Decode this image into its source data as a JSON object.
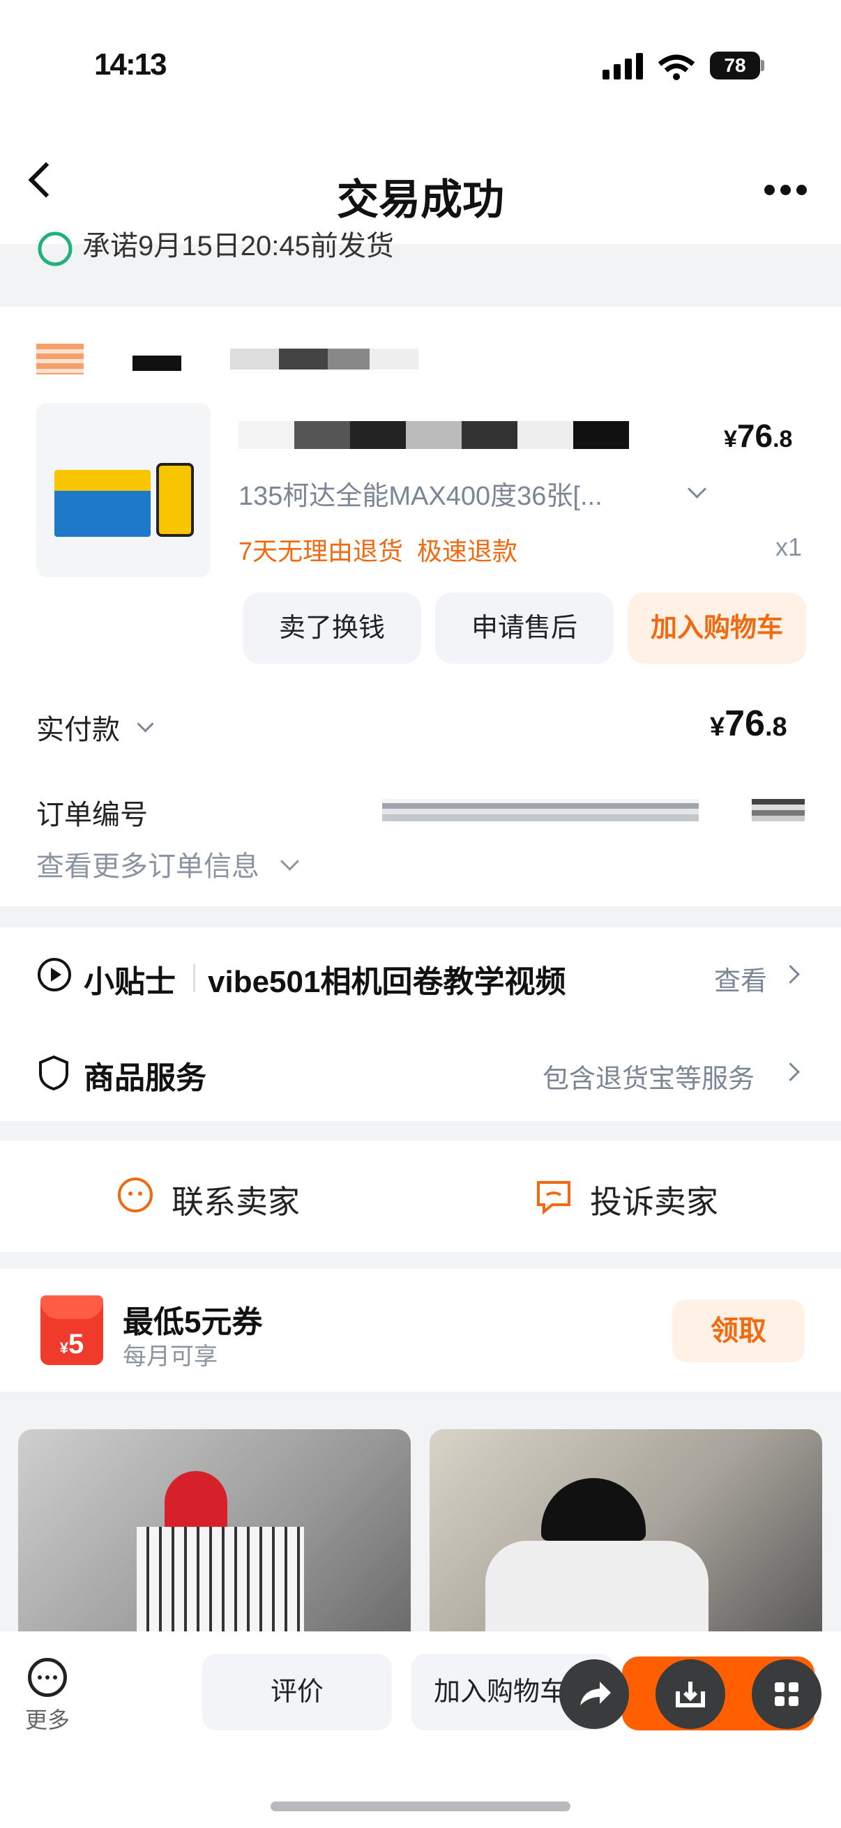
{
  "status_bar": {
    "time": "14:13",
    "battery": "78"
  },
  "nav": {
    "title": "交易成功"
  },
  "shipping": {
    "promise": "承诺9月15日20:45前发货"
  },
  "order": {
    "product_spec": "135柯达全能MAX400度36张[...",
    "price_symbol": "¥",
    "price_int": "76",
    "price_dec": ".8",
    "refund_tag1": "7天无理由退货",
    "refund_tag2": "极速退款",
    "quantity": "x1",
    "buttons": {
      "sell": "卖了换钱",
      "after_sale": "申请售后",
      "add_cart": "加入购物车"
    },
    "paid_label": "实付款",
    "paid_int": "76",
    "paid_dec": ".8",
    "order_no_label": "订单编号",
    "more_info": "查看更多订单信息"
  },
  "tips": {
    "label": "小贴士",
    "text": "vibe501相机回卷教学视频",
    "link": "查看"
  },
  "service": {
    "label": "商品服务",
    "link": "包含退货宝等服务"
  },
  "contact": {
    "seller": "联系卖家",
    "complain": "投诉卖家"
  },
  "coupon": {
    "badge": "5",
    "title": "最低5元券",
    "subtitle": "每月可享",
    "claim": "领取"
  },
  "bottom_bar": {
    "more": "更多",
    "review": "评价",
    "add_cart": "加入购物车"
  },
  "colors": {
    "accent": "#ff5f00",
    "orange_text": "#f06a11",
    "muted": "#7a8695"
  }
}
